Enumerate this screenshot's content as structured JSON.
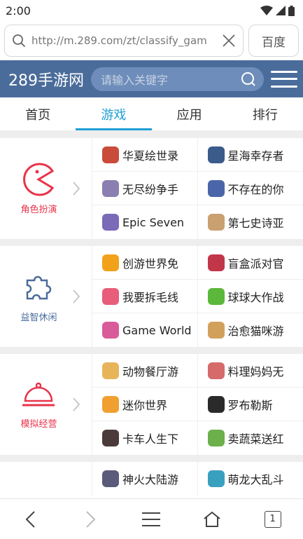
{
  "status": {
    "time": "2:00"
  },
  "browser": {
    "url": "http://m.289.com/zt/classify_gam",
    "side_button": "百度",
    "tab_count": "1"
  },
  "site": {
    "logo": "289手游网",
    "search_placeholder": "请输入关键字"
  },
  "tabs": [
    {
      "label": "首页"
    },
    {
      "label": "游戏"
    },
    {
      "label": "应用"
    },
    {
      "label": "排行"
    }
  ],
  "categories": [
    {
      "label": "角色扮演",
      "color": "#e8344a",
      "games": [
        {
          "name": "华夏绘世录",
          "color": "#c94b3a"
        },
        {
          "name": "星海幸存者",
          "color": "#3b5b8a"
        },
        {
          "name": "无尽纷争手",
          "color": "#8a7fb0"
        },
        {
          "name": "不存在的你",
          "color": "#4a66a8"
        },
        {
          "name": "Epic Seven",
          "color": "#7a6ab8"
        },
        {
          "name": "第七史诗亚",
          "color": "#c9a070"
        }
      ]
    },
    {
      "label": "益智休闲",
      "color": "#4a6c9a",
      "games": [
        {
          "name": "创游世界免",
          "color": "#f1a21a"
        },
        {
          "name": "盲盒派对官",
          "color": "#c2364a"
        },
        {
          "name": "我要拆毛线",
          "color": "#e85d7a"
        },
        {
          "name": "球球大作战",
          "color": "#5cb83a"
        },
        {
          "name": "Game World",
          "color": "#d95c9a"
        },
        {
          "name": "治愈猫咪游",
          "color": "#d1a15c"
        }
      ]
    },
    {
      "label": "模拟经营",
      "color": "#e8344a",
      "games": [
        {
          "name": "动物餐厅游",
          "color": "#e8b45a"
        },
        {
          "name": "料理妈妈无",
          "color": "#d66a6a"
        },
        {
          "name": "迷你世界",
          "color": "#f0a030"
        },
        {
          "name": "罗布勒斯",
          "color": "#2a2a2a"
        },
        {
          "name": "卡车人生下",
          "color": "#4a3a3a"
        },
        {
          "name": "卖蔬菜送红",
          "color": "#6bb04a"
        }
      ]
    },
    {
      "label": "",
      "color": "#f4a623",
      "games": [
        {
          "name": "神火大陆游",
          "color": "#5a5a7a"
        },
        {
          "name": "萌龙大乱斗",
          "color": "#3aa0c0"
        }
      ]
    }
  ]
}
